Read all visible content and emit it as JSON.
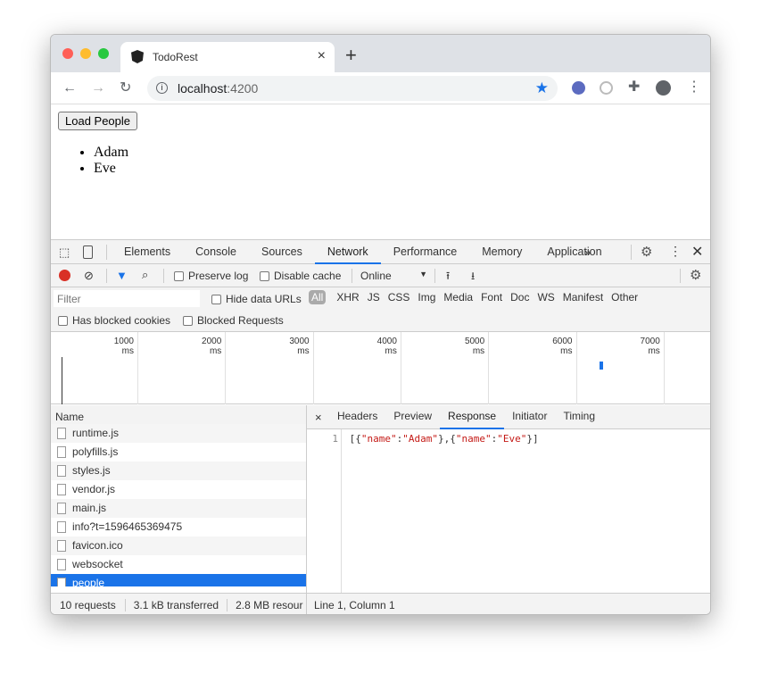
{
  "browser": {
    "tab_title": "TodoRest",
    "url_host": "localhost",
    "url_port": ":4200"
  },
  "page": {
    "button": "Load People",
    "items": [
      "Adam",
      "Eve"
    ]
  },
  "devtools": {
    "tabs": [
      "Elements",
      "Console",
      "Sources",
      "Network",
      "Performance",
      "Memory",
      "Application"
    ],
    "active_tab": "Network",
    "toolbar": {
      "preserve_log": "Preserve log",
      "disable_cache": "Disable cache",
      "throttle": "Online"
    },
    "filter": {
      "placeholder": "Filter",
      "hide_data_urls": "Hide data URLs",
      "types": [
        "All",
        "XHR",
        "JS",
        "CSS",
        "Img",
        "Media",
        "Font",
        "Doc",
        "WS",
        "Manifest",
        "Other"
      ],
      "has_blocked_cookies": "Has blocked cookies",
      "blocked_requests": "Blocked Requests"
    },
    "timeline_ticks": [
      "1000 ms",
      "2000 ms",
      "3000 ms",
      "4000 ms",
      "5000 ms",
      "6000 ms",
      "7000 ms"
    ],
    "list_header": "Name",
    "requests": [
      "runtime.js",
      "polyfills.js",
      "styles.js",
      "vendor.js",
      "main.js",
      "info?t=1596465369475",
      "favicon.ico",
      "websocket",
      "people"
    ],
    "selected": "people",
    "detail_tabs": [
      "Headers",
      "Preview",
      "Response",
      "Initiator",
      "Timing"
    ],
    "active_detail": "Response",
    "response": {
      "line_no": "1",
      "p1": "[{",
      "k1": "\"name\"",
      "c1": ":",
      "v1": "\"Adam\"",
      "p2": "},{",
      "k2": "\"name\"",
      "c2": ":",
      "v2": "\"Eve\"",
      "p3": "}]"
    },
    "status": {
      "requests": "10 requests",
      "transferred": "3.1 kB transferred",
      "resources": "2.8 MB resour",
      "cursor": "Line 1, Column 1"
    },
    "colors": {
      "accent": "#1a73e8",
      "string": "#c41a16",
      "record": "#d93025"
    }
  }
}
